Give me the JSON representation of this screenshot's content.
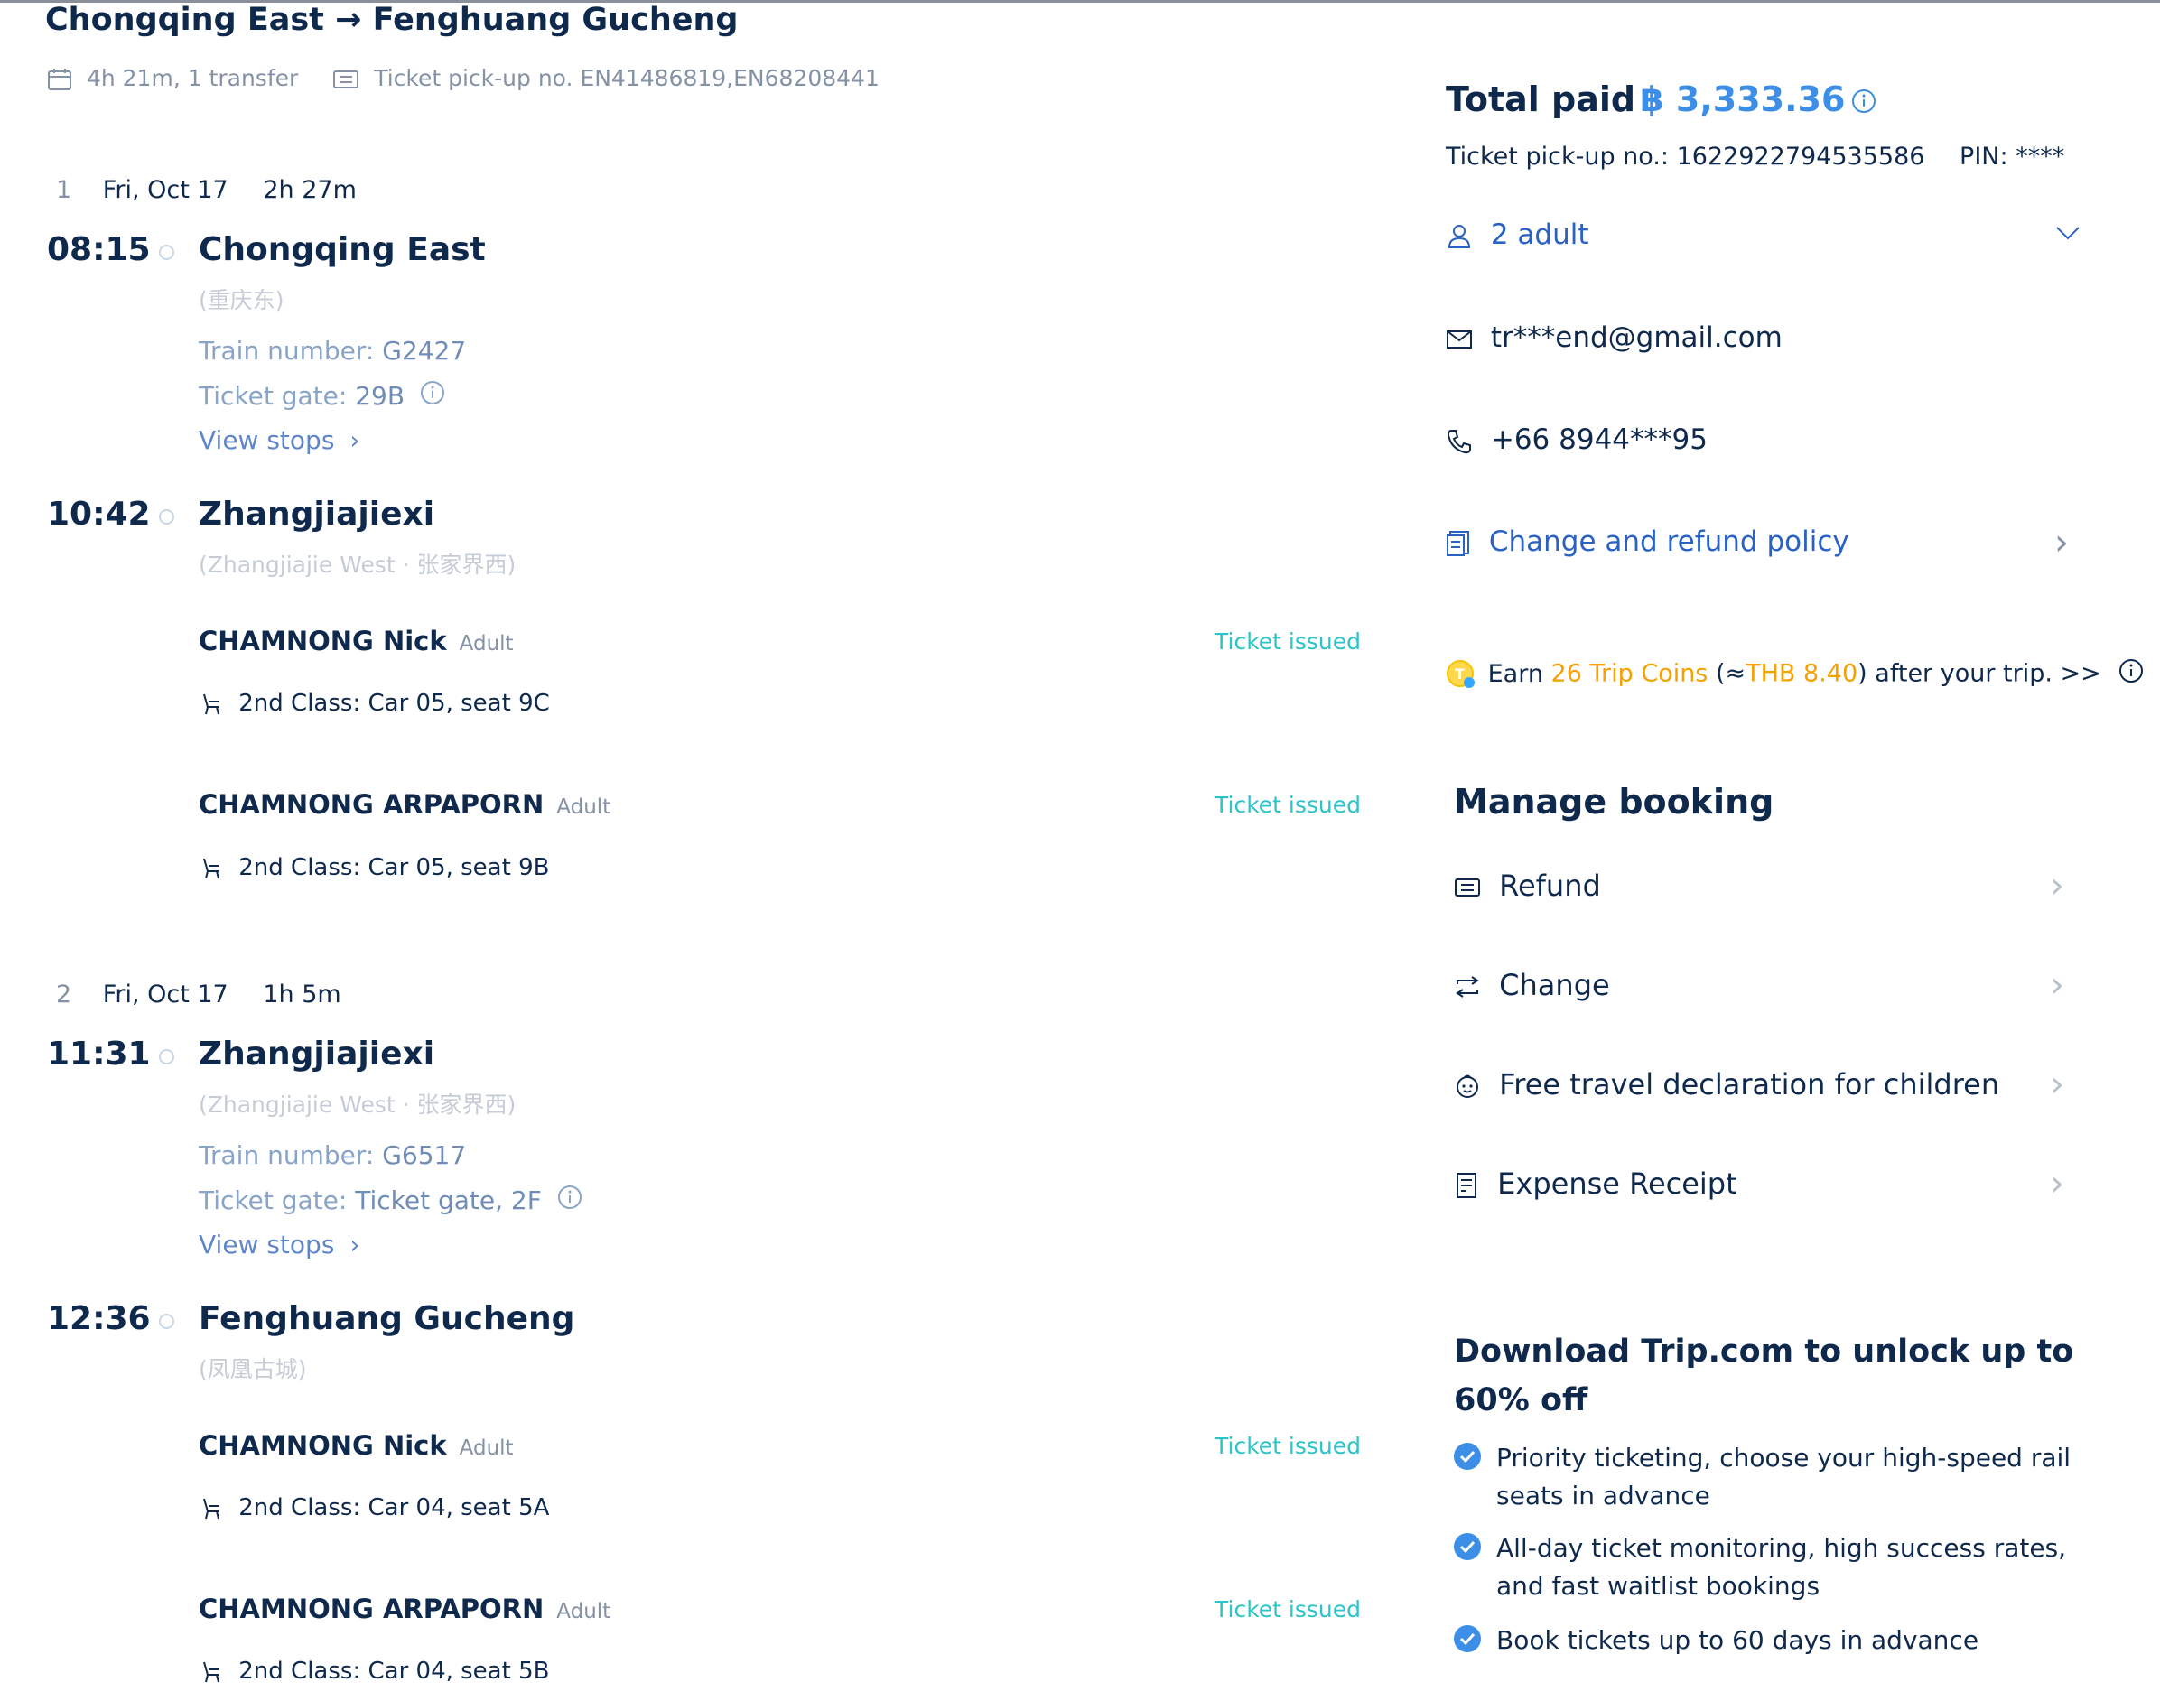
{
  "header": {
    "origin": "Chongqing East",
    "arrow": "→",
    "destination": "Fenghuang Gucheng",
    "duration_transfers": "4h 21m, 1 transfer",
    "pickup_label": "Ticket pick-up no.",
    "pickup_numbers": "EN41486819,EN68208441"
  },
  "legs": [
    {
      "index": "1",
      "date": "Fri, Oct 17",
      "duration": "2h 27m",
      "depart_time": "08:15",
      "depart_station": "Chongqing East",
      "depart_sub": "(重庆东)",
      "train_label": "Train number:",
      "train_number": "G2427",
      "gate_label": "Ticket gate:",
      "gate": "29B",
      "view_stops": "View stops",
      "arrive_time": "10:42",
      "arrive_station": "Zhangjiajiexi",
      "arrive_sub": "(Zhangjiajie West · 张家界西)",
      "passengers": [
        {
          "name": "CHAMNONG Nick",
          "type": "Adult",
          "status": "Ticket issued",
          "seat": "2nd Class: Car 05, seat 9C"
        },
        {
          "name": "CHAMNONG ARPAPORN",
          "type": "Adult",
          "status": "Ticket issued",
          "seat": "2nd Class: Car 05, seat 9B"
        }
      ]
    },
    {
      "index": "2",
      "date": "Fri, Oct 17",
      "duration": "1h 5m",
      "depart_time": "11:31",
      "depart_station": "Zhangjiajiexi",
      "depart_sub": "(Zhangjiajie West · 张家界西)",
      "train_label": "Train number:",
      "train_number": "G6517",
      "gate_label": "Ticket gate:",
      "gate": "Ticket gate, 2F",
      "view_stops": "View stops",
      "arrive_time": "12:36",
      "arrive_station": "Fenghuang Gucheng",
      "arrive_sub": "(凤凰古城)",
      "passengers": [
        {
          "name": "CHAMNONG Nick",
          "type": "Adult",
          "status": "Ticket issued",
          "seat": "2nd Class: Car 04, seat 5A"
        },
        {
          "name": "CHAMNONG ARPAPORN",
          "type": "Adult",
          "status": "Ticket issued",
          "seat": "2nd Class: Car 04, seat 5B"
        }
      ]
    }
  ],
  "summary": {
    "total_label": "Total paid",
    "total_amount": "฿ 3,333.36",
    "pickup_label": "Ticket pick-up no.:",
    "pickup_number": "1622922794535586",
    "pin_label": "PIN:",
    "pin": "****",
    "passengers": "2 adult",
    "email": "tr***end@gmail.com",
    "phone": "+66 8944***95",
    "policy": "Change and refund policy",
    "coins": {
      "earn": "Earn",
      "coins": "26 Trip Coins",
      "approx_open": "(≈",
      "thb": "THB 8.40",
      "rest": ") after your trip. >>"
    }
  },
  "manage": {
    "title": "Manage booking",
    "items": [
      {
        "label": "Refund",
        "icon": "ticket-icon"
      },
      {
        "label": "Change",
        "icon": "swap-icon"
      },
      {
        "label": "Free travel declaration for children",
        "icon": "child-face-icon"
      },
      {
        "label": "Expense Receipt",
        "icon": "receipt-icon"
      }
    ]
  },
  "promo": {
    "title": "Download Trip.com to unlock up to 60% off",
    "bullets": [
      "Priority ticketing, choose your high-speed rail seats in advance",
      "All-day ticket monitoring, high success rates, and fast waitlist bookings",
      "Book tickets up to 60 days in advance"
    ]
  },
  "colors": {
    "navy": "#0f294d",
    "blue": "#3d8ee6",
    "teal": "#2cc3c9",
    "gold": "#f5a100",
    "muted": "#8592a6"
  }
}
